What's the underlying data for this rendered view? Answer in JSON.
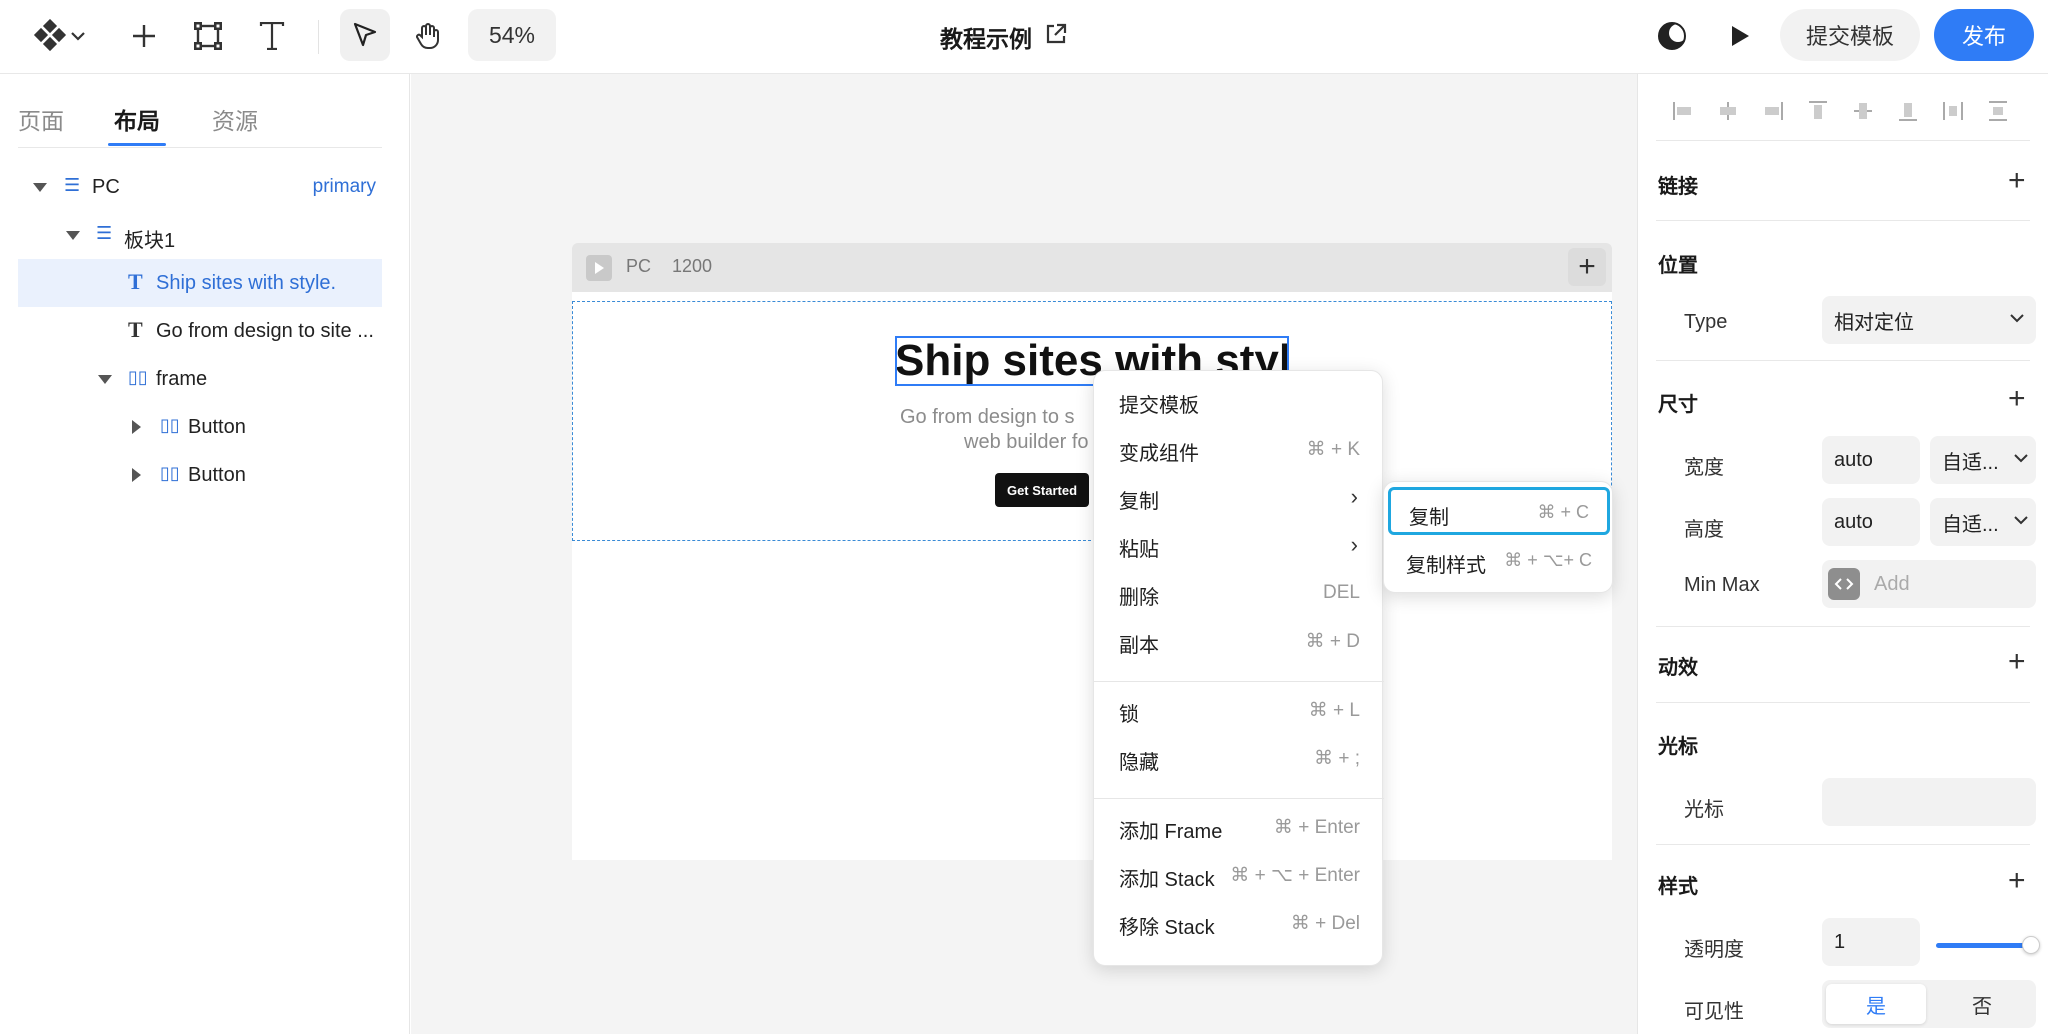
{
  "toolbar": {
    "zoom": "54%",
    "doc_title": "教程示例",
    "template_button": "提交模板",
    "publish_button": "发布",
    "icons": [
      "logo-diamond-icon",
      "chevron-down-icon",
      "plus-icon",
      "frame-icon",
      "text-tool-icon",
      "pointer-icon",
      "hand-icon",
      "external-link-icon",
      "theme-moon-icon",
      "play-icon"
    ]
  },
  "left_panel": {
    "tabs": [
      "页面",
      "布局",
      "资源"
    ],
    "active_tab": "布局",
    "tree": [
      {
        "label": "PC",
        "tag": "primary"
      },
      {
        "label": "板块1"
      },
      {
        "label": "Ship sites with style."
      },
      {
        "label": "Go from design to site ..."
      },
      {
        "label": "frame"
      },
      {
        "label": "Button"
      },
      {
        "label": "Button"
      }
    ]
  },
  "canvas": {
    "frame_name": "PC",
    "frame_width": "1200",
    "hero_title": "Ship sites with style",
    "hero_sub_line1": "Go from design to s",
    "hero_sub_line2": "web builder fo",
    "cta_label": "Get Started"
  },
  "context_menu": {
    "items": [
      {
        "label": "提交模板",
        "shortcut": ""
      },
      {
        "label": "变成组件",
        "shortcut": "⌘ + K"
      },
      {
        "label": "复制",
        "shortcut": "",
        "submenu": true
      },
      {
        "label": "粘贴",
        "shortcut": "",
        "submenu": true
      },
      {
        "label": "删除",
        "shortcut": "DEL"
      },
      {
        "label": "副本",
        "shortcut": "⌘ + D"
      },
      {
        "label": "锁",
        "shortcut": "⌘ + L"
      },
      {
        "label": "隐藏",
        "shortcut": "⌘ + ;"
      },
      {
        "label": "添加 Frame",
        "shortcut": "⌘ + Enter"
      },
      {
        "label": "添加 Stack",
        "shortcut": "⌘ + ⌥ + Enter"
      },
      {
        "label": "移除 Stack",
        "shortcut": "⌘ + Del"
      }
    ],
    "submenu": [
      {
        "label": "复制",
        "shortcut": "⌘ + C"
      },
      {
        "label": "复制样式",
        "shortcut": "⌘ + ⌥+ C"
      }
    ]
  },
  "right_panel": {
    "link": {
      "title": "链接"
    },
    "position": {
      "title": "位置",
      "type_label": "Type",
      "type_value": "相对定位"
    },
    "size": {
      "title": "尺寸",
      "width_label": "宽度",
      "width_value": "auto",
      "width_mode": "自适...",
      "height_label": "高度",
      "height_value": "auto",
      "height_mode": "自适...",
      "minmax_label": "Min Max",
      "minmax_placeholder": "Add"
    },
    "motion": {
      "title": "动效"
    },
    "cursor": {
      "title": "光标",
      "cursor_label": "光标",
      "cursor_value": ""
    },
    "style": {
      "title": "样式",
      "opacity_label": "透明度",
      "opacity_value": "1",
      "opacity_level": 1,
      "visibility_label": "可见性",
      "visibility_yes": "是",
      "visibility_no": "否",
      "visibility_selected": "是"
    }
  },
  "colors": {
    "accent": "#2f7cf6",
    "selection_border": "#1fa7e0",
    "canvas_bg": "#f4f4f4"
  }
}
